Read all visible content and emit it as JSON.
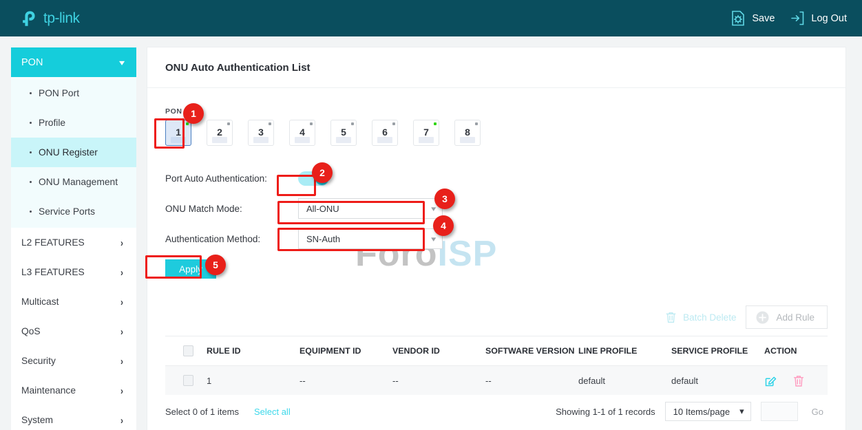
{
  "header": {
    "brand": "tp-link",
    "save_label": "Save",
    "logout_label": "Log Out"
  },
  "sidebar": {
    "group_title": "PON",
    "items": [
      {
        "label": "PON Port"
      },
      {
        "label": "Profile"
      },
      {
        "label": "ONU Register"
      },
      {
        "label": "ONU Management"
      },
      {
        "label": "Service Ports"
      }
    ],
    "groups": [
      {
        "label": "L2 FEATURES"
      },
      {
        "label": "L3 FEATURES"
      },
      {
        "label": "Multicast"
      },
      {
        "label": "QoS"
      },
      {
        "label": "Security"
      },
      {
        "label": "Maintenance"
      },
      {
        "label": "System"
      }
    ]
  },
  "main": {
    "card_title": "ONU Auto Authentication List",
    "watermark_primary": "Foro",
    "watermark_secondary": "ISP",
    "pon_label": "PON",
    "ports": [
      {
        "number": "1",
        "status": "on",
        "selected": true
      },
      {
        "number": "2",
        "status": "off",
        "selected": false
      },
      {
        "number": "3",
        "status": "off",
        "selected": false
      },
      {
        "number": "4",
        "status": "off",
        "selected": false
      },
      {
        "number": "5",
        "status": "off",
        "selected": false
      },
      {
        "number": "6",
        "status": "off",
        "selected": false
      },
      {
        "number": "7",
        "status": "on",
        "selected": false
      },
      {
        "number": "8",
        "status": "off",
        "selected": false
      }
    ],
    "form": {
      "auto_auth_label": "Port Auto Authentication:",
      "auto_auth_state": "on",
      "match_mode_label": "ONU Match Mode:",
      "match_mode_value": "All-ONU",
      "auth_method_label": "Authentication Method:",
      "auth_method_value": "SN-Auth",
      "apply_label": "Apply"
    },
    "annotations": [
      {
        "number": "1"
      },
      {
        "number": "2"
      },
      {
        "number": "3"
      },
      {
        "number": "4"
      },
      {
        "number": "5"
      }
    ],
    "toolbar": {
      "batch_delete_label": "Batch Delete",
      "add_rule_label": "Add Rule"
    },
    "table": {
      "columns": [
        "RULE ID",
        "EQUIPMENT ID",
        "VENDOR ID",
        "SOFTWARE VERSION",
        "LINE PROFILE",
        "SERVICE PROFILE",
        "ACTION"
      ],
      "rows": [
        {
          "rule_id": "1",
          "equipment_id": "--",
          "vendor_id": "--",
          "software_version": "--",
          "line_profile": "default",
          "service_profile": "default"
        }
      ]
    },
    "footer": {
      "select_info": "Select 0 of 1 items",
      "select_all_label": "Select all",
      "showing": "Showing 1-1 of 1 records",
      "page_size": "10 Items/page",
      "page_input_value": "",
      "go_label": "Go"
    }
  },
  "colors": {
    "brand_dark": "#0a4e5e",
    "accent_cyan": "#15cddb",
    "annotation_red": "#e8201a",
    "status_green": "#2fd60d"
  }
}
